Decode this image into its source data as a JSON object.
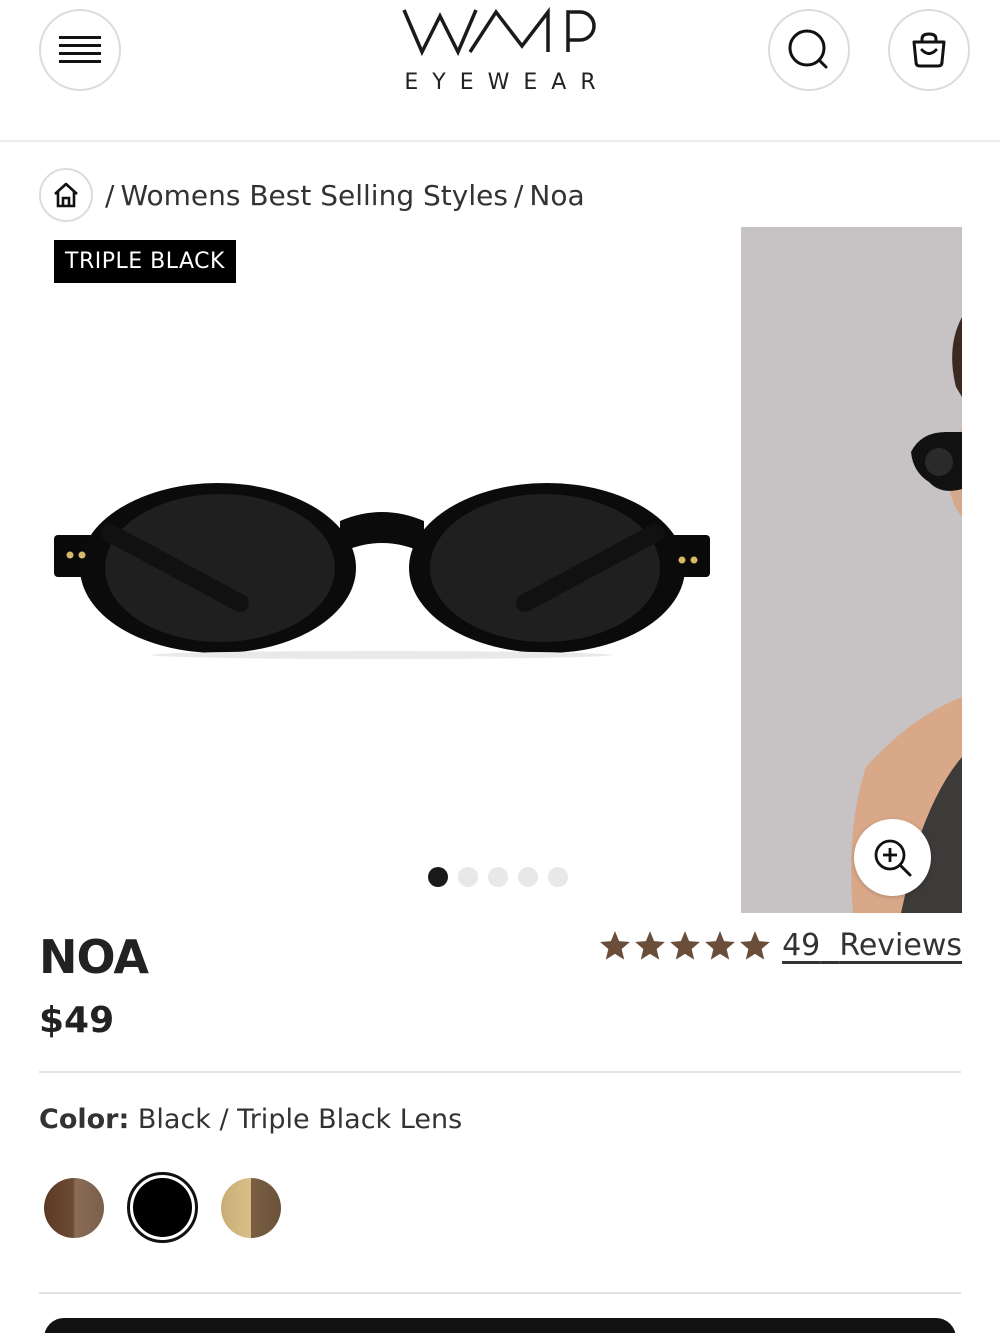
{
  "header": {
    "logo_mark": "WMP",
    "logo_sub": "EYEWEAR",
    "menu_icon": "hamburger-menu-icon",
    "search_icon": "search-icon",
    "cart_icon": "shopping-bag-icon"
  },
  "breadcrumb": {
    "home_icon": "home-icon",
    "separator": "/",
    "items": [
      "Womens Best Selling Styles",
      "Noa"
    ]
  },
  "gallery": {
    "badge": "TRIPLE BLACK",
    "dots_total": 5,
    "active_dot": 1,
    "zoom_icon": "zoom-in-icon"
  },
  "product": {
    "name": "NOA",
    "price": "$49",
    "rating_stars": 5,
    "rating_color": "#6b4e3a",
    "reviews_count": "49",
    "reviews_label": "Reviews",
    "color_label": "Color:",
    "color_value": "Black / Triple Black Lens",
    "swatches": [
      "tortoise",
      "black",
      "gold"
    ],
    "selected_swatch": "black"
  }
}
